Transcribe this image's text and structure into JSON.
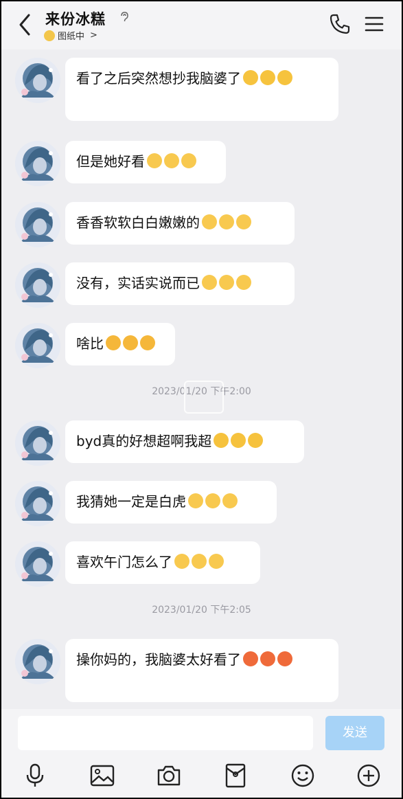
{
  "header": {
    "title": "来份冰糕",
    "status": "图纸中",
    "status_chevron": ">"
  },
  "messages": [
    {
      "text": "看了之后突然想抄我脑婆了",
      "emoji": [
        "plead",
        "plead",
        "plead"
      ]
    },
    {
      "text": "但是她好看",
      "emoji": [
        "cute",
        "cute",
        "cute"
      ]
    },
    {
      "text": "香香软软白白嫩嫩的",
      "emoji": [
        "cute",
        "cute",
        "cute"
      ]
    },
    {
      "text": "没有，实话实说而已",
      "emoji": [
        "cute",
        "cute",
        "cute"
      ]
    },
    {
      "text": "啥比",
      "emoji": [
        "tongue",
        "tongue",
        "tongue"
      ]
    },
    {
      "text": "byd真的好想超啊我超",
      "emoji": [
        "cry",
        "cry",
        "cry"
      ]
    },
    {
      "text": "我猜她一定是白虎",
      "emoji": [
        "cute",
        "cute",
        "cute"
      ]
    },
    {
      "text": "喜欢午门怎么了",
      "emoji": [
        "cute",
        "cute",
        "cute"
      ]
    },
    {
      "text": "操你妈的，我脑婆太好看了",
      "emoji": [
        "angry",
        "angry",
        "angry"
      ]
    }
  ],
  "timestamps": [
    "2023/01/20 下午2:00",
    "2023/01/20 下午2:05"
  ],
  "input": {
    "placeholder": "",
    "send_label": "发送"
  },
  "toolbar": [
    "mic-icon",
    "image-icon",
    "camera-icon",
    "red-packet-icon",
    "emoji-icon",
    "plus-icon"
  ],
  "colors": {
    "background": "#eeeef1",
    "bubble": "#ffffff",
    "send_button": "#a7d3f7"
  }
}
